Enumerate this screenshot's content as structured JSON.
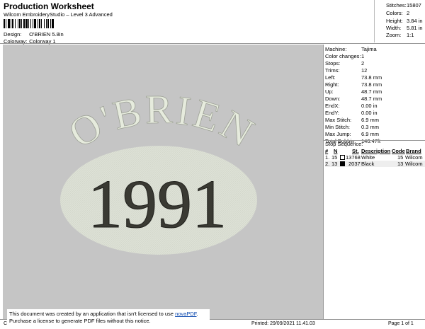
{
  "header": {
    "title": "Production Worksheet",
    "subtitle": "Wilcom EmbroideryStudio – Level 3 Advanced",
    "design_label": "Design:",
    "design_value": "O'BRIEN 5.8in",
    "colorway_label": "Colorway:",
    "colorway_value": "Colorway 1"
  },
  "top_stats": [
    {
      "k": "Stitches:",
      "v": "15807"
    },
    {
      "k": "Colors:",
      "v": "2"
    },
    {
      "k": "Height:",
      "v": "3.84 in"
    },
    {
      "k": "Width:",
      "v": "5.81 in"
    },
    {
      "k": "Zoom:",
      "v": "1:1"
    }
  ],
  "design": {
    "arc_text": "O'BRIEN",
    "year_text": "1991",
    "background_color": "#c5c5c5",
    "oval_color": "#dde1d6",
    "arc_color": "#e6ebdd",
    "year_color": "#3a3a33"
  },
  "machine_info": [
    {
      "k": "Machine:",
      "v": "Tajima"
    },
    {
      "k": "Color changes:",
      "v": "1"
    },
    {
      "k": "Stops:",
      "v": "2"
    },
    {
      "k": "Trims:",
      "v": "12"
    },
    {
      "k": "Left:",
      "v": "73.8 mm"
    },
    {
      "k": "Right:",
      "v": "73.8 mm"
    },
    {
      "k": "Up:",
      "v": "48.7 mm"
    },
    {
      "k": "Down:",
      "v": "48.7 mm"
    },
    {
      "k": "EndX:",
      "v": "0.00 in"
    },
    {
      "k": "EndY:",
      "v": "0.00 in"
    },
    {
      "k": "Max Stitch:",
      "v": "6.9 mm"
    },
    {
      "k": "Min Stitch:",
      "v": "0.3 mm"
    },
    {
      "k": "Max Jump:",
      "v": "6.9 mm"
    },
    {
      "k": "Total Bobbin:",
      "v": "140.47ft"
    }
  ],
  "stop_sequence": {
    "label": "Stop Sequence:",
    "headers": {
      "num": "#",
      "n": "N",
      "st": "St.",
      "desc": "Description",
      "code": "Code",
      "brand": "Brand"
    },
    "rows": [
      {
        "num": "1.",
        "n": "15",
        "st": "13768",
        "desc": "White",
        "code": "15",
        "brand": "Wilcom",
        "color": "#ffffff"
      },
      {
        "num": "2.",
        "n": "13",
        "st": "2037",
        "desc": "Black",
        "code": "13",
        "brand": "Wilcom",
        "color": "#000000"
      }
    ]
  },
  "footer": {
    "left": "Cr",
    "printed": "Printed: 29/09/2021 11.41.03",
    "page": "Page 1 of 1"
  },
  "notice": {
    "line1_prefix": "This document was created by an application that isn't licensed to use ",
    "link": "novaPDF",
    "line1_suffix": ".",
    "line2": "Purchase a license to generate PDF files without this notice."
  }
}
